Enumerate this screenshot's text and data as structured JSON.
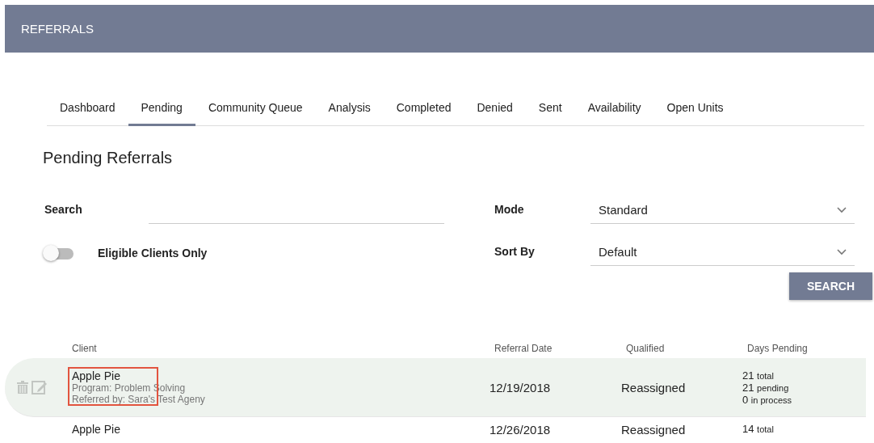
{
  "header": {
    "title": "REFERRALS"
  },
  "tabs": [
    {
      "label": "Dashboard",
      "selected": false
    },
    {
      "label": "Pending",
      "selected": true
    },
    {
      "label": "Community Queue",
      "selected": false
    },
    {
      "label": "Analysis",
      "selected": false
    },
    {
      "label": "Completed",
      "selected": false
    },
    {
      "label": "Denied",
      "selected": false
    },
    {
      "label": "Sent",
      "selected": false
    },
    {
      "label": "Availability",
      "selected": false
    },
    {
      "label": "Open Units",
      "selected": false
    }
  ],
  "page_title": "Pending Referrals",
  "filters": {
    "search_label": "Search",
    "eligible_toggle": {
      "label": "Eligible Clients Only",
      "on": false
    },
    "mode": {
      "label": "Mode",
      "value": "Standard"
    },
    "sort_by": {
      "label": "Sort By",
      "value": "Default"
    },
    "search_button": "SEARCH"
  },
  "table": {
    "columns": [
      "Client",
      "Referral Date",
      "Qualified",
      "Days Pending"
    ],
    "rows": [
      {
        "client": "Apple Pie",
        "program": "Program: Problem Solving",
        "referred_by": "Referred by: Sara's Test Ageny",
        "date": "12/19/2018",
        "qualified": "Reassigned",
        "days": [
          {
            "n": "21",
            "unit": "total"
          },
          {
            "n": "21",
            "unit": "pending"
          },
          {
            "n": "0",
            "unit": "in process"
          }
        ],
        "selected": true,
        "highlighted": true
      },
      {
        "client": "Apple Pie",
        "date": "12/26/2018",
        "qualified": "Reassigned",
        "days": [
          {
            "n": "14",
            "unit": "total"
          }
        ],
        "selected": false,
        "highlighted": false
      }
    ]
  }
}
